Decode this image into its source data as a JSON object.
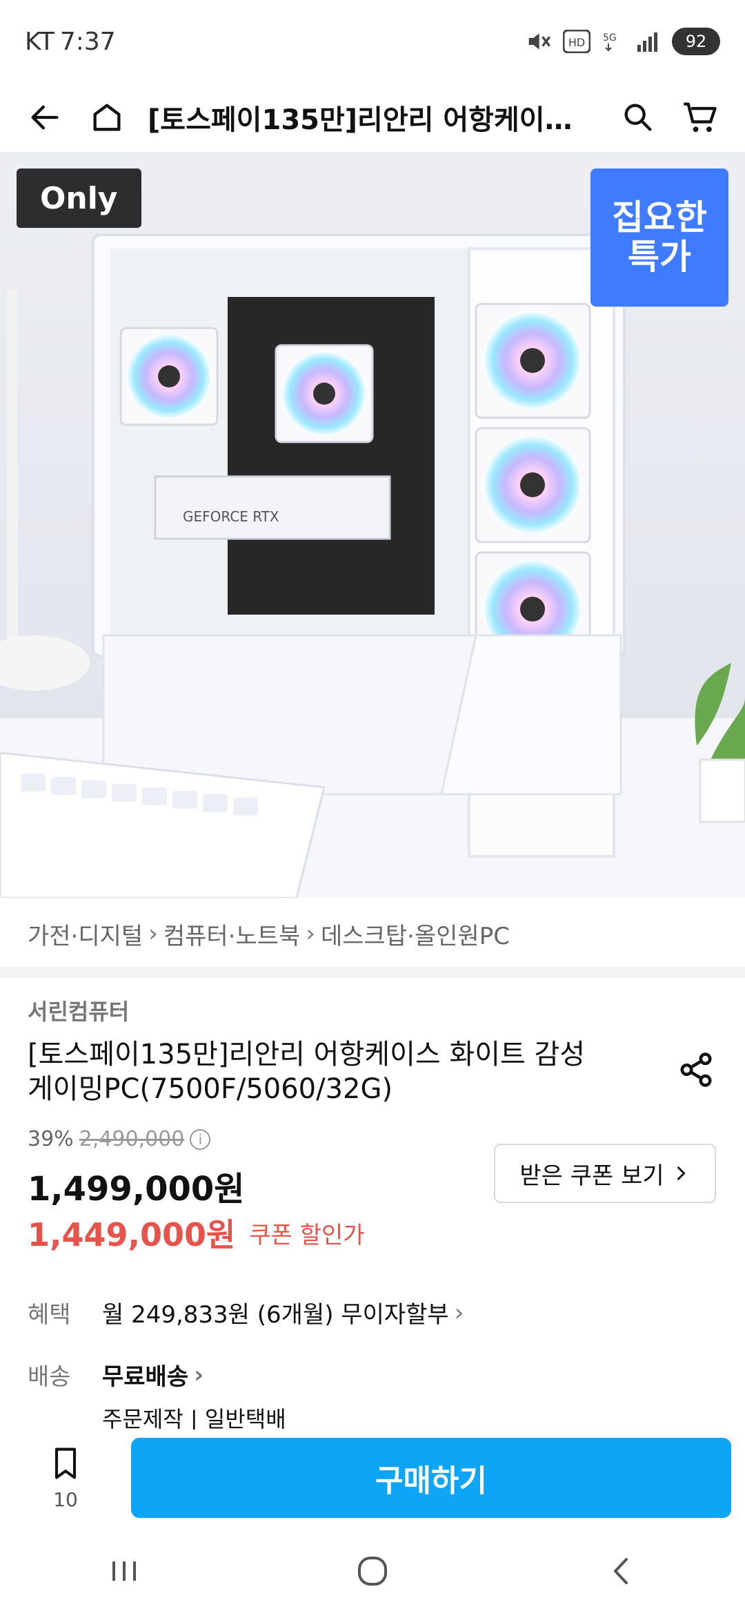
{
  "status_bar": {
    "carrier": "KT",
    "time": "7:37",
    "battery": "92"
  },
  "header": {
    "title": "[토스페이135만]리안리 어항케이스 화이트 감성 게이밍PC(7500F/5060/32G)"
  },
  "hero": {
    "only_badge": "Only",
    "promo_badge_line1": "집요한",
    "promo_badge_line2": "특가"
  },
  "breadcrumb": [
    "가전·디지털",
    "컴퓨터·노트북",
    "데스크탑·올인원PC"
  ],
  "product": {
    "seller": "서린컴퓨터",
    "title_line1": "[토스페이135만]리안리 어항케이스 화이트 감성",
    "title_line2": "게이밍PC(7500F/5060/32G)",
    "discount": "39%",
    "original_price": "2,490,000",
    "price": "1,499,000원",
    "coupon_price": "1,449,000원",
    "coupon_label": "쿠폰 할인가",
    "coupon_button": "받은 쿠폰 보기"
  },
  "benefits": {
    "label": "혜택",
    "value": "월 249,833원 (6개월) 무이자할부"
  },
  "shipping": {
    "label": "배송",
    "value": "무료배송",
    "subtext": "주문제작 | 일반택배"
  },
  "actions": {
    "bookmark_count": "10",
    "buy_label": "구매하기"
  },
  "colors": {
    "accent_blue": "#0ea5f7",
    "coupon_red": "#e5534b",
    "promo_blue": "#3f7bff"
  }
}
